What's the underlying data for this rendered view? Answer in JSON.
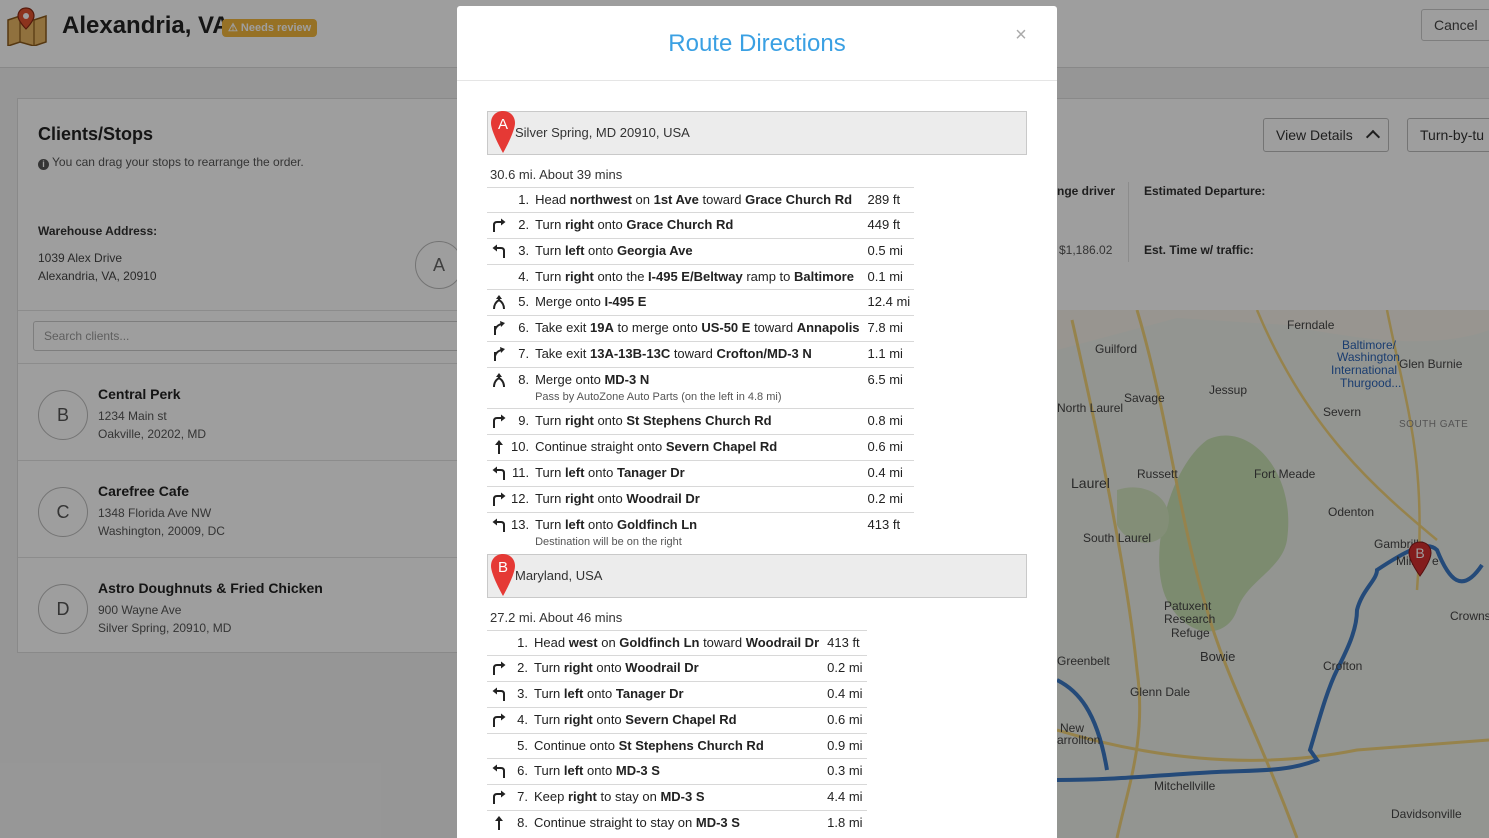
{
  "header": {
    "title": "Alexandria, VA",
    "badge": "⚠ Needs review",
    "cancel_label": "Cancel"
  },
  "clients_panel": {
    "title": "Clients/Stops",
    "help": "You can drag your stops to rearrange the order.",
    "warehouse_label": "Warehouse Address:",
    "warehouse_line1": "1039 Alex Drive",
    "warehouse_line2": "Alexandria, VA, 20910",
    "warehouse_letter": "A",
    "search_placeholder": "Search clients...",
    "clients": [
      {
        "letter": "B",
        "name": "Central Perk",
        "addr1": "1234 Main st",
        "addr2": "Oakville, 20202, MD"
      },
      {
        "letter": "C",
        "name": "Carefree Cafe",
        "addr1": "1348 Florida Ave NW",
        "addr2": "Washington, 20009, DC"
      },
      {
        "letter": "D",
        "name": "Astro Doughnuts & Fried Chicken",
        "addr1": "900 Wayne Ave",
        "addr2": "Silver Spring, 20910, MD"
      }
    ]
  },
  "right_panel": {
    "view_details_label": "View Details",
    "turn_by_turn_label": "Turn-by-tu",
    "driver_label": "nge driver",
    "driver_value": "$1,186.02",
    "departure_label": "Estimated Departure:",
    "traffic_label": "Est. Time w/ traffic:"
  },
  "map": {
    "labels": [
      "Ferndale",
      "Baltimore/",
      "Washington",
      "International",
      "Thurgood...",
      "Glen Burnie",
      "Guilford",
      "Jessup",
      "North Laurel",
      "Savage",
      "Severn",
      "SOUTH GATE",
      "Russett",
      "Fort Meade",
      "Laurel",
      "Odenton",
      "South Laurel",
      "Gambrills",
      "Mille",
      "e",
      "Patuxent",
      "Research",
      "Refuge",
      "Crowns",
      "Greenbelt",
      "Bowie",
      "Crofton",
      "Glenn Dale",
      "New",
      "arrollton",
      "Mitchellville",
      "Davidsonville"
    ],
    "shields": [
      "95",
      "1",
      "713",
      "1",
      "170",
      "95",
      "97",
      "198",
      "97",
      "200",
      "197",
      "193",
      "193",
      "450",
      "424",
      "50",
      "495",
      "410",
      "704",
      "50",
      "450",
      "3"
    ],
    "pin_letter": "B"
  },
  "modal": {
    "title": "Route Directions",
    "close": "×",
    "legs": [
      {
        "pin": "A",
        "address": "Silver Spring, MD 20910, USA",
        "summary": "30.6 mi. About 39 mins",
        "steps": [
          {
            "icon": "none",
            "num": "1.",
            "parts": [
              "Head ",
              "northwest",
              " on ",
              "1st Ave",
              " toward ",
              "Grace Church Rd"
            ],
            "dist": "289 ft"
          },
          {
            "icon": "turn-right",
            "num": "2.",
            "parts": [
              "Turn ",
              "right",
              " onto ",
              "Grace Church Rd"
            ],
            "dist": "449 ft"
          },
          {
            "icon": "turn-left",
            "num": "3.",
            "parts": [
              "Turn ",
              "left",
              " onto ",
              "Georgia Ave"
            ],
            "dist": "0.5 mi"
          },
          {
            "icon": "none",
            "num": "4.",
            "parts": [
              "Turn ",
              "right",
              " onto the ",
              "I-495 E/Beltway",
              " ramp to ",
              "Baltimore"
            ],
            "dist": "0.1 mi"
          },
          {
            "icon": "merge",
            "num": "5.",
            "parts": [
              "Merge onto ",
              "I-495 E"
            ],
            "dist": "12.4 mi"
          },
          {
            "icon": "ramp-right",
            "num": "6.",
            "parts": [
              "Take exit ",
              "19A",
              " to merge onto ",
              "US-50 E",
              " toward ",
              "Annapolis"
            ],
            "dist": "7.8 mi"
          },
          {
            "icon": "ramp-right",
            "num": "7.",
            "parts": [
              "Take exit ",
              "13A-13B-13C",
              " toward ",
              "Crofton/MD-3 N"
            ],
            "dist": "1.1 mi"
          },
          {
            "icon": "merge",
            "num": "8.",
            "parts": [
              "Merge onto ",
              "MD-3 N"
            ],
            "note": "Pass by AutoZone Auto Parts (on the left in 4.8 mi)",
            "dist": "6.5 mi"
          },
          {
            "icon": "turn-right",
            "num": "9.",
            "parts": [
              "Turn ",
              "right",
              " onto ",
              "St Stephens Church Rd"
            ],
            "dist": "0.8 mi"
          },
          {
            "icon": "straight",
            "num": "10.",
            "parts": [
              "Continue straight onto ",
              "Severn Chapel Rd"
            ],
            "dist": "0.6 mi"
          },
          {
            "icon": "turn-left",
            "num": "11.",
            "parts": [
              "Turn ",
              "left",
              " onto ",
              "Tanager Dr"
            ],
            "dist": "0.4 mi"
          },
          {
            "icon": "turn-right",
            "num": "12.",
            "parts": [
              "Turn ",
              "right",
              " onto ",
              "Woodrail Dr"
            ],
            "dist": "0.2 mi"
          },
          {
            "icon": "turn-left",
            "num": "13.",
            "parts": [
              "Turn ",
              "left",
              " onto ",
              "Goldfinch Ln"
            ],
            "note": "Destination will be on the right",
            "dist": "413 ft"
          }
        ]
      },
      {
        "pin": "B",
        "address": "Maryland, USA",
        "summary": "27.2 mi. About 46 mins",
        "steps": [
          {
            "icon": "none",
            "num": "1.",
            "parts": [
              "Head ",
              "west",
              " on ",
              "Goldfinch Ln",
              " toward ",
              "Woodrail Dr"
            ],
            "dist": "413 ft"
          },
          {
            "icon": "turn-right",
            "num": "2.",
            "parts": [
              "Turn ",
              "right",
              " onto ",
              "Woodrail Dr"
            ],
            "dist": "0.2 mi"
          },
          {
            "icon": "turn-left",
            "num": "3.",
            "parts": [
              "Turn ",
              "left",
              " onto ",
              "Tanager Dr"
            ],
            "dist": "0.4 mi"
          },
          {
            "icon": "turn-right",
            "num": "4.",
            "parts": [
              "Turn ",
              "right",
              " onto ",
              "Severn Chapel Rd"
            ],
            "dist": "0.6 mi"
          },
          {
            "icon": "none",
            "num": "5.",
            "parts": [
              "Continue onto ",
              "St Stephens Church Rd"
            ],
            "dist": "0.9 mi"
          },
          {
            "icon": "turn-left",
            "num": "6.",
            "parts": [
              "Turn ",
              "left",
              " onto ",
              "MD-3 S"
            ],
            "dist": "0.3 mi"
          },
          {
            "icon": "turn-right",
            "num": "7.",
            "parts": [
              "Keep ",
              "right",
              " to stay on ",
              "MD-3 S"
            ],
            "dist": "4.4 mi"
          },
          {
            "icon": "straight",
            "num": "8.",
            "parts": [
              "Continue straight to stay on ",
              "MD-3 S"
            ],
            "dist": "1.8 mi"
          }
        ]
      }
    ]
  },
  "colors": {
    "modal_title": "#3aa0e3",
    "pin_red": "#e53935",
    "route_blue": "#3b78c4",
    "badge": "#f2b63d"
  }
}
